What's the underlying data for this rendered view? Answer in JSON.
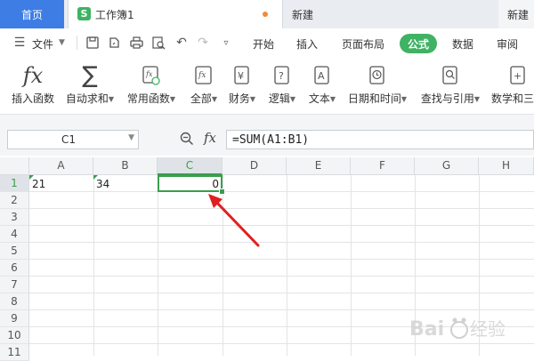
{
  "tabs": {
    "home": "首页",
    "workbook": "工作簿1",
    "new1": "新建",
    "new2": "新建"
  },
  "menu": {
    "file": "文件",
    "items": [
      "开始",
      "插入",
      "页面布局",
      "公式",
      "数据",
      "审阅"
    ],
    "active": "公式"
  },
  "ribbon": {
    "tools": [
      {
        "label": "插入函数",
        "icon": "fx-icon"
      },
      {
        "label": "自动求和",
        "icon": "sigma-icon"
      },
      {
        "label": "常用函数",
        "icon": "common-functions-icon"
      },
      {
        "label": "全部",
        "icon": "all-functions-icon"
      },
      {
        "label": "财务",
        "icon": "finance-icon"
      },
      {
        "label": "逻辑",
        "icon": "logic-icon"
      },
      {
        "label": "文本",
        "icon": "text-icon"
      },
      {
        "label": "日期和时间",
        "icon": "clock-icon"
      },
      {
        "label": "查找与引用",
        "icon": "lookup-icon"
      },
      {
        "label": "数学和三",
        "icon": "math-icon"
      }
    ]
  },
  "formula_bar": {
    "name_box": "C1",
    "fx": "fx",
    "formula": "=SUM(A1:B1)"
  },
  "sheet": {
    "columns": [
      "A",
      "B",
      "C",
      "D",
      "E",
      "F",
      "G",
      "H"
    ],
    "rows": [
      "1",
      "2",
      "3",
      "4",
      "5",
      "6",
      "7",
      "8",
      "9",
      "10",
      "11"
    ],
    "cells": {
      "A1": "21",
      "B1": "34",
      "C1": "0"
    },
    "selected": "C1"
  },
  "watermark": "Baidu经验",
  "colors": {
    "accent_green": "#3fb263",
    "home_tab_blue": "#3d7de4",
    "arrow_red": "#e02020"
  }
}
